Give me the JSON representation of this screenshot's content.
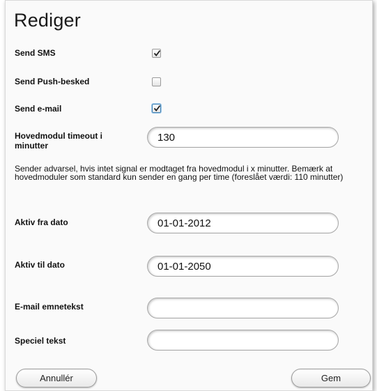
{
  "title": "Rediger",
  "fields": {
    "send_sms": {
      "label": "Send SMS",
      "checked": true
    },
    "send_push": {
      "label": "Send Push-besked",
      "checked": false
    },
    "send_email": {
      "label": "Send e-mail",
      "checked": true
    },
    "timeout": {
      "label": "Hovedmodul timeout i minutter",
      "value": "130"
    },
    "help_text": "Sender advarsel, hvis intet signal er modtaget fra hovedmodul i x minutter. Bemærk at hovedmoduler som standard kun sender en gang per time (foreslået værdi: 110 minutter)",
    "active_from": {
      "label": "Aktiv fra dato",
      "value": "01-01-2012"
    },
    "active_to": {
      "label": "Aktiv til dato",
      "value": "01-01-2050"
    },
    "email_subject": {
      "label": "E-mail emnetekst",
      "value": ""
    },
    "special_text": {
      "label": "Speciel tekst",
      "value": ""
    }
  },
  "buttons": {
    "cancel": "Annullér",
    "save": "Gem"
  },
  "icons": {
    "check": "check-icon"
  },
  "colors": {
    "focus_border": "#3c7fb1",
    "check_mark": "#222222"
  }
}
